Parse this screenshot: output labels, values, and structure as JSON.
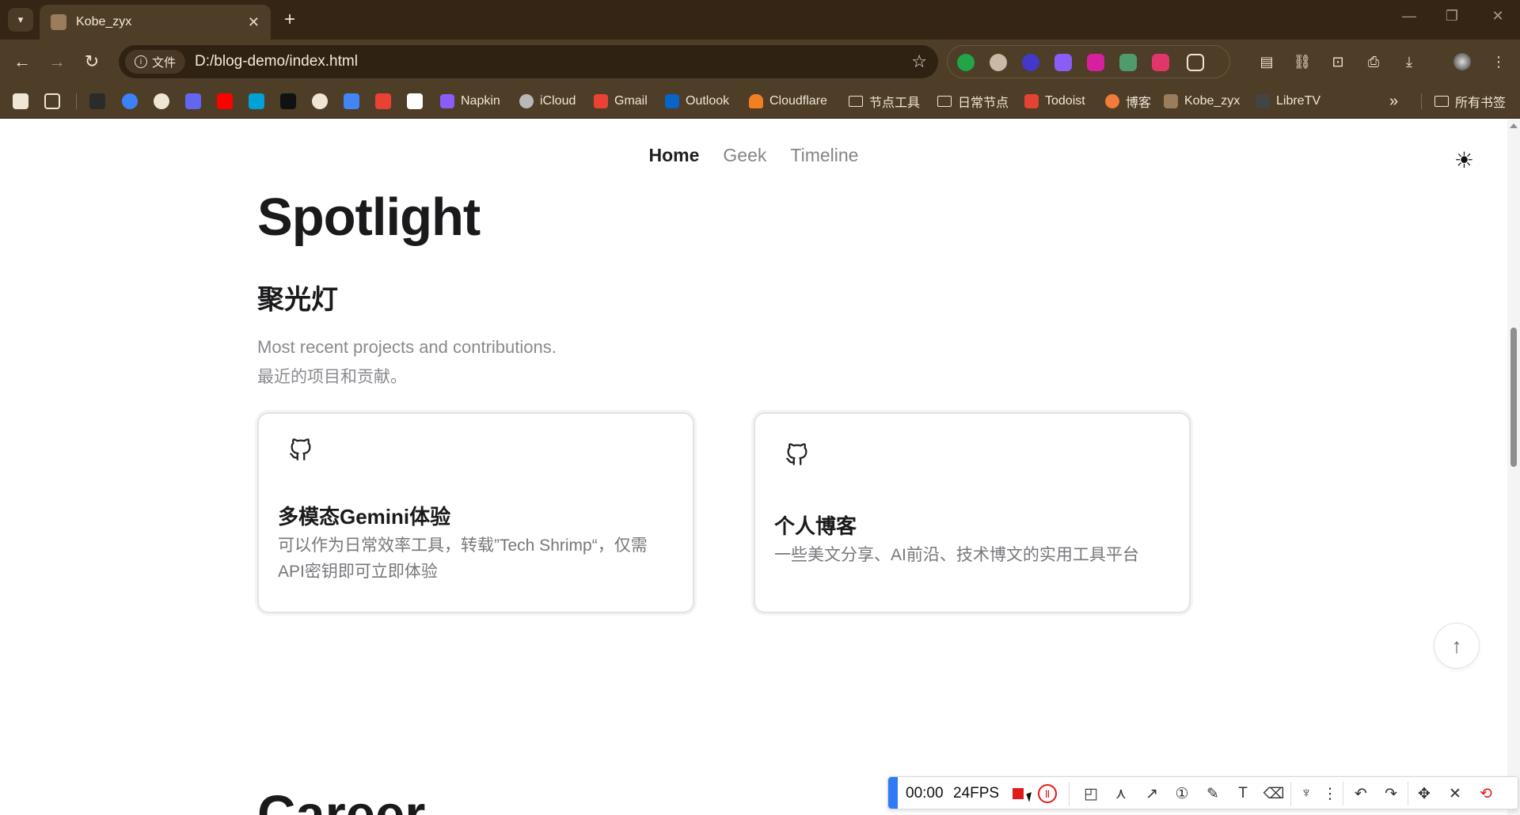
{
  "browser": {
    "tab_title": "Kobe_zyx",
    "tab_close": "✕",
    "new_tab": "+",
    "site_chip": "文件",
    "url": "D:/blog-demo/index.html",
    "bookmarks": [
      {
        "label": "Napkin",
        "color": "#8b5cf6"
      },
      {
        "label": "iCloud",
        "color": "#b8b8b8"
      },
      {
        "label": "Gmail",
        "color": "#ea4335"
      },
      {
        "label": "Outlook",
        "color": "#0a64c8"
      },
      {
        "label": "Cloudflare",
        "color": "#f38020"
      },
      {
        "label": "节点工具",
        "color": "folder"
      },
      {
        "label": "日常节点",
        "color": "folder"
      },
      {
        "label": "Todoist",
        "color": "#e44232"
      },
      {
        "label": "博客",
        "color": "#f07b3a"
      },
      {
        "label": "Kobe_zyx",
        "color": "#9b7c5c"
      },
      {
        "label": "LibreTV",
        "color": "#444444"
      }
    ],
    "bookmarks_more": "»",
    "all_bookmarks": "所有书签"
  },
  "page": {
    "nav": [
      {
        "label": "Home",
        "active": true
      },
      {
        "label": "Geek",
        "active": false
      },
      {
        "label": "Timeline",
        "active": false
      }
    ],
    "heading": "Spotlight",
    "heading_cn": "聚光灯",
    "subtitle_en": "Most recent projects and contributions.",
    "subtitle_cn": "最近的项目和贡献。",
    "cards": [
      {
        "title": "多模态Gemini体验",
        "description": "可以作为日常效率工具，转载”Tech Shrimp“，仅需API密钥即可立即体验",
        "icon": "github-icon"
      },
      {
        "title": "个人博客",
        "description": "一些美文分享、AI前沿、技术博文的实用工具平台",
        "icon": "github-icon"
      }
    ],
    "next_heading": "Career",
    "scroll_top": "↑"
  },
  "recorder": {
    "time": "00:00",
    "fps": "24FPS"
  },
  "colors": {
    "chrome_dark": "#342514",
    "chrome_mid": "#4e3d27",
    "record_red": "#e21a1a",
    "recorder_accent": "#2f7bf6"
  }
}
